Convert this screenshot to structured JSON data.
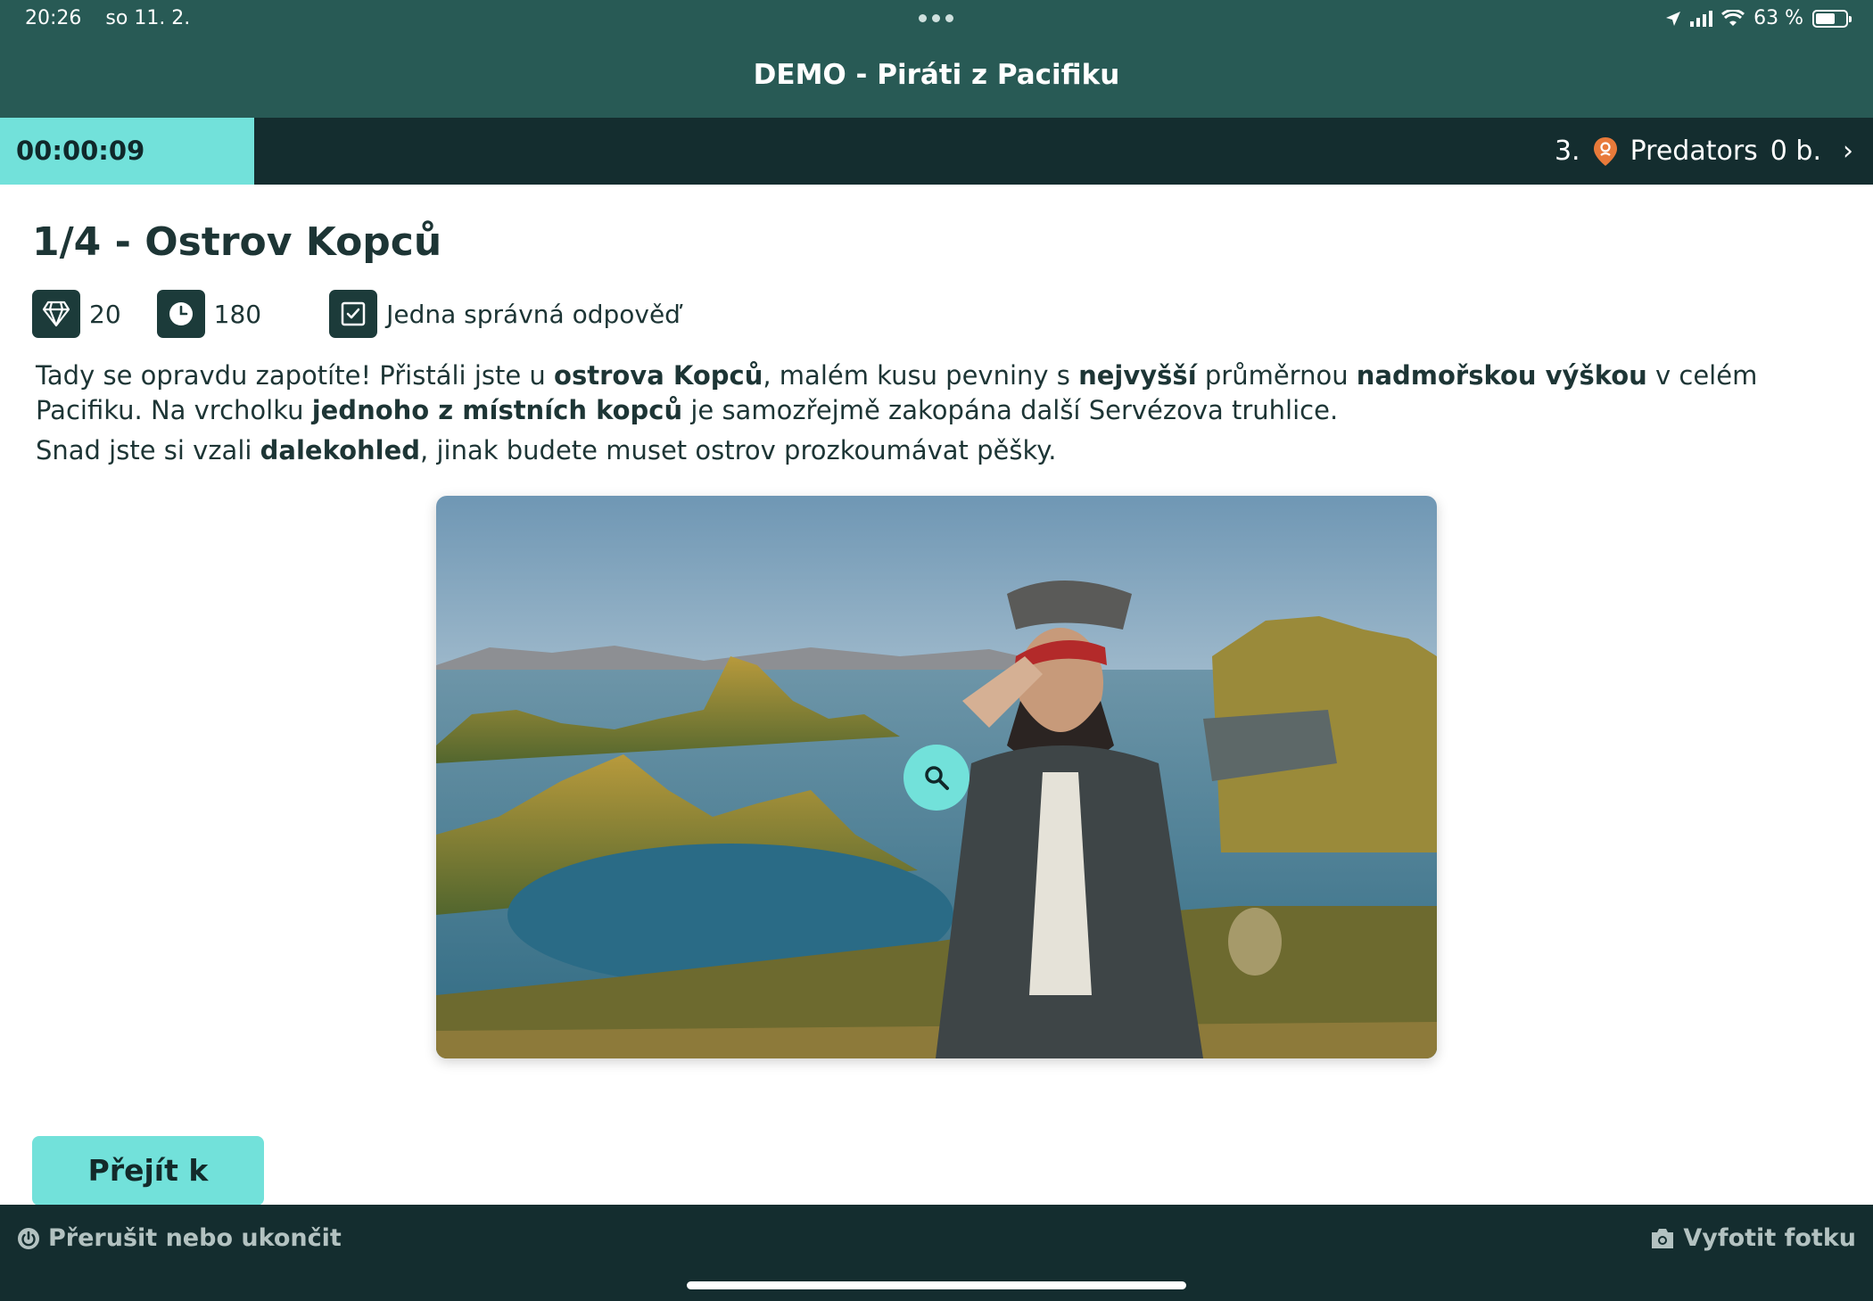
{
  "status_bar": {
    "time": "20:26",
    "date": "so 11. 2.",
    "battery": "63 %",
    "battery_level": 0.63
  },
  "app": {
    "title": "DEMO - Piráti z Pacifiku"
  },
  "timer": "00:00:09",
  "team": {
    "rank": "3.",
    "name": "Predators",
    "points": "0 b.",
    "pin_color": "#e87a3a"
  },
  "task": {
    "title": "1/4 - Ostrov Kopců",
    "points": "20",
    "time_limit": "180",
    "answer_type": "Jedna správná odpověď",
    "description": {
      "p1": [
        {
          "t": "Tady se opravdu zapotíte! Přistáli jste u ",
          "b": false
        },
        {
          "t": "ostrova Kopců",
          "b": true
        },
        {
          "t": ", malém kusu pevniny s ",
          "b": false
        },
        {
          "t": "nejvyšší",
          "b": true
        },
        {
          "t": " průměrnou ",
          "b": false
        },
        {
          "t": "nadmořskou výškou",
          "b": true
        },
        {
          "t": " v celém Pacifiku. Na vrcholku ",
          "b": false
        },
        {
          "t": "jednoho z místních kopců",
          "b": true
        },
        {
          "t": " je samozřejmě zakopána další Servézova truhlice.",
          "b": false
        }
      ],
      "p2": [
        {
          "t": "Snad jste si vzali ",
          "b": false
        },
        {
          "t": "dalekohled",
          "b": true
        },
        {
          "t": ", jinak budete muset ostrov prozkoumávat pěšky.",
          "b": false
        }
      ]
    }
  },
  "buttons": {
    "go_to_question": "Přejít k otázce",
    "quit": "Přerušit nebo ukončit",
    "take_photo": "Vyfotit fotku"
  },
  "colors": {
    "header": "#285a55",
    "dark_bar": "#142d2f",
    "accent": "#72e1da",
    "text": "#1d3535"
  }
}
